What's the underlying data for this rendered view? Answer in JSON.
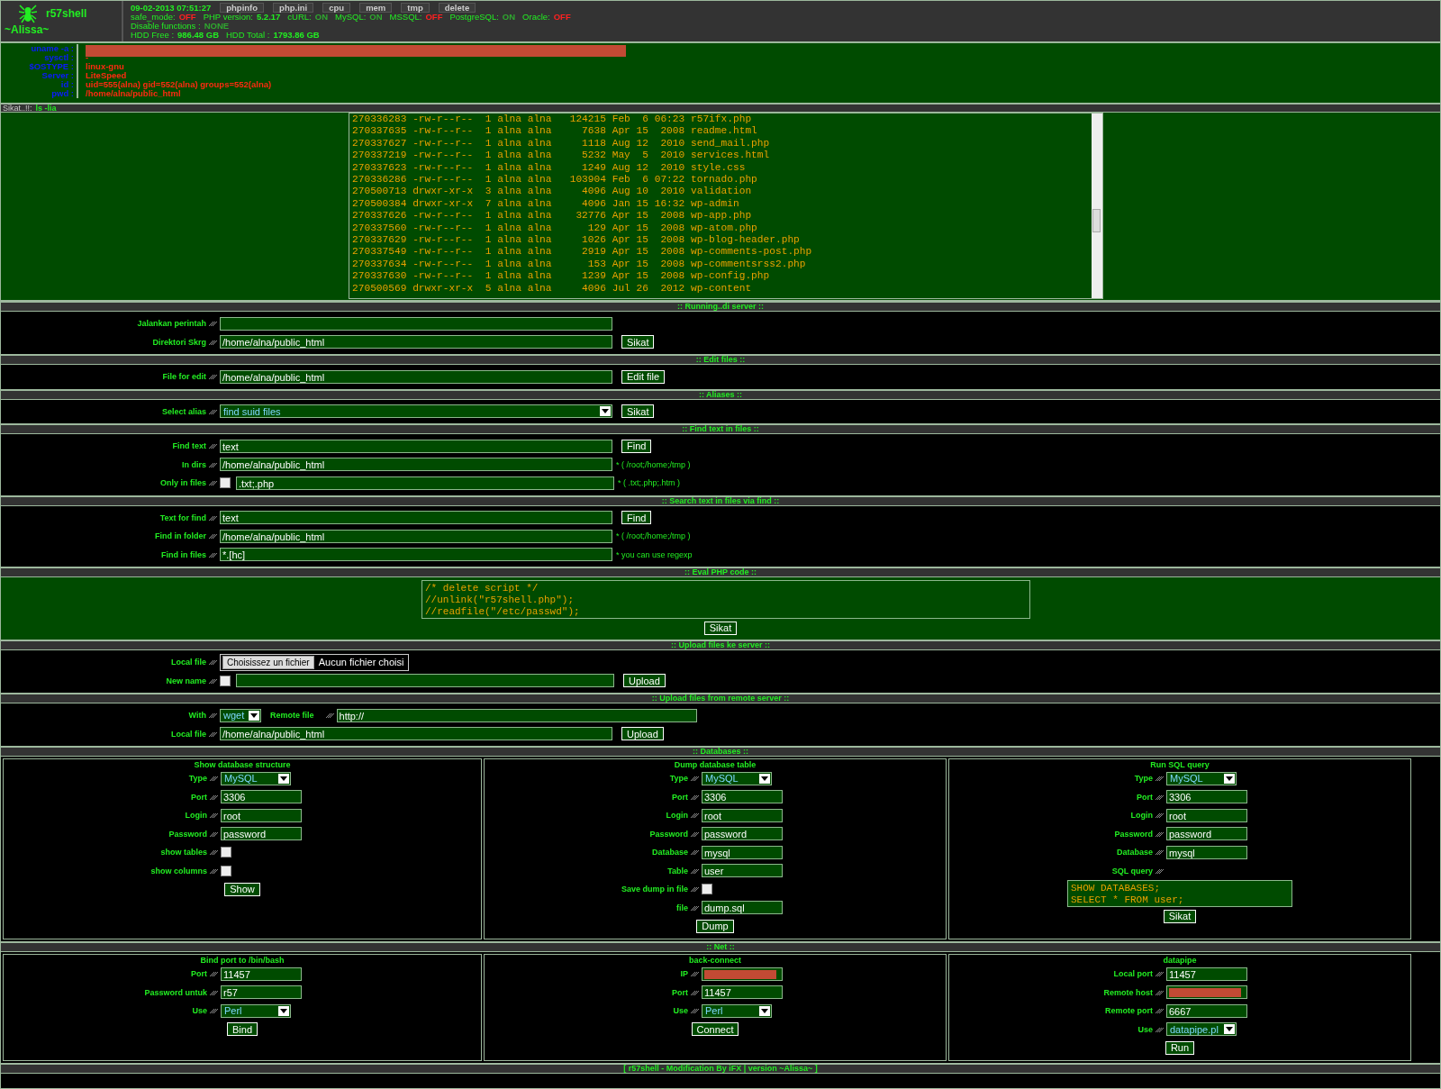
{
  "header": {
    "logo_name": "r57shell",
    "user": "~Alissa~",
    "datetime": "09-02-2013 07:51:27",
    "menu": [
      "phpinfo",
      "php.ini",
      "cpu",
      "mem",
      "tmp",
      "delete"
    ],
    "status": [
      {
        "label": "safe_mode:",
        "value": "OFF",
        "on": false
      },
      {
        "label": "PHP version:",
        "value": "5.2.17"
      },
      {
        "label": "cURL:",
        "value": "ON",
        "on": true
      },
      {
        "label": "MySQL:",
        "value": "ON",
        "on": true
      },
      {
        "label": "MSSQL:",
        "value": "OFF",
        "on": false
      },
      {
        "label": "PostgreSQL:",
        "value": "ON",
        "on": true
      },
      {
        "label": "Oracle:",
        "value": "OFF",
        "on": false
      }
    ],
    "disable_functions": {
      "label": "Disable functions :",
      "value": "NONE"
    },
    "hdd": {
      "free_label": "HDD Free :",
      "free": "986.48 GB",
      "total_label": "HDD Total :",
      "total": "1793.86 GB"
    }
  },
  "info": [
    {
      "label": "uname -a :",
      "redacted": true
    },
    {
      "label": "sysctl :",
      "value": "-"
    },
    {
      "label": "$OSTYPE :",
      "value": "linux-gnu"
    },
    {
      "label": "Server :",
      "value": "LiteSpeed"
    },
    {
      "label": "id :",
      "value": "uid=555(alna) gid=552(alna) groups=552(alna)"
    },
    {
      "label": "pwd :",
      "value": "/home/alna/public_html"
    }
  ],
  "command": {
    "label": "Sikat..!!:",
    "value": "ls -lia"
  },
  "listing": [
    "270336283 -rw-r--r--  1 alna alna   124215 Feb  6 06:23 r57ifx.php",
    "270337635 -rw-r--r--  1 alna alna     7638 Apr 15  2008 readme.html",
    "270337627 -rw-r--r--  1 alna alna     1118 Aug 12  2010 send_mail.php",
    "270337219 -rw-r--r--  1 alna alna     5232 May  5  2010 services.html",
    "270337623 -rw-r--r--  1 alna alna     1249 Aug 12  2010 style.css",
    "270336286 -rw-r--r--  1 alna alna   103904 Feb  6 07:22 tornado.php",
    "270500713 drwxr-xr-x  3 alna alna     4096 Aug 10  2010 validation",
    "270500384 drwxr-xr-x  7 alna alna     4096 Jan 15 16:32 wp-admin",
    "270337626 -rw-r--r--  1 alna alna    32776 Apr 15  2008 wp-app.php",
    "270337560 -rw-r--r--  1 alna alna      129 Apr 15  2008 wp-atom.php",
    "270337629 -rw-r--r--  1 alna alna     1026 Apr 15  2008 wp-blog-header.php",
    "270337549 -rw-r--r--  1 alna alna     2919 Apr 15  2008 wp-comments-post.php",
    "270337634 -rw-r--r--  1 alna alna      153 Apr 15  2008 wp-commentsrss2.php",
    "270337630 -rw-r--r--  1 alna alna     1239 Apr 15  2008 wp-config.php",
    "270500569 drwxr-xr-x  5 alna alna     4096 Jul 26  2012 wp-content"
  ],
  "sections": [
    {
      "title": ":: Running..di server ::",
      "kind": "form",
      "rows": [
        {
          "label": "Jalankan perintah",
          "items": [
            {
              "kind": "input"
            }
          ]
        },
        {
          "label": "Direktori Skrg",
          "items": [
            {
              "kind": "input",
              "value": "/home/alna/public_html"
            },
            {
              "kind": "button",
              "label": "Sikat"
            }
          ]
        }
      ]
    },
    {
      "title": ":: Edit files ::",
      "kind": "form",
      "rows": [
        {
          "label": "File for edit",
          "items": [
            {
              "kind": "input",
              "value": "/home/alna/public_html"
            },
            {
              "kind": "button",
              "label": "Edit file"
            }
          ]
        }
      ]
    },
    {
      "title": ":: Aliases ::",
      "kind": "form",
      "rows": [
        {
          "label": "Select alias",
          "items": [
            {
              "kind": "select",
              "value": "find suid files"
            },
            {
              "kind": "button",
              "label": "Sikat"
            }
          ]
        }
      ]
    },
    {
      "title": ":: Find text in files ::",
      "kind": "form",
      "rows": [
        {
          "label": "Find text",
          "items": [
            {
              "kind": "input",
              "value": "text"
            },
            {
              "kind": "button",
              "label": "Find"
            }
          ]
        },
        {
          "label": "In dirs",
          "items": [
            {
              "kind": "input",
              "value": "/home/alna/public_html"
            },
            {
              "kind": "hint",
              "text": "* ( /root;/home;/tmp )"
            }
          ]
        },
        {
          "label": "Only in files",
          "items": [
            {
              "kind": "checkbox",
              "checked": false
            },
            {
              "kind": "input",
              "value": ".txt;.php"
            },
            {
              "kind": "hint",
              "text": "* ( .txt;.php;.htm )"
            }
          ]
        }
      ]
    },
    {
      "title": ":: Search text in files via find ::",
      "kind": "form",
      "rows": [
        {
          "label": "Text for find",
          "items": [
            {
              "kind": "input",
              "value": "text"
            },
            {
              "kind": "button",
              "label": "Find"
            }
          ]
        },
        {
          "label": "Find in folder",
          "items": [
            {
              "kind": "input",
              "value": "/home/alna/public_html"
            },
            {
              "kind": "hint",
              "text": "* ( /root;/home;/tmp )"
            }
          ]
        },
        {
          "label": "Find in files",
          "items": [
            {
              "kind": "input",
              "value": "*.[hc]"
            },
            {
              "kind": "hint",
              "text": "* you can use regexp"
            }
          ]
        }
      ]
    },
    {
      "title": ":: Eval PHP code ::",
      "kind": "centered",
      "rows": [
        {
          "items": [
            {
              "kind": "textarea",
              "lines": [
                "/* delete script */",
                "//unlink(\"r57shell.php\");",
                "//readfile(\"/etc/passwd\");"
              ]
            }
          ]
        },
        {
          "items": [
            {
              "kind": "button",
              "label": "Sikat"
            }
          ]
        }
      ]
    },
    {
      "title": ":: Upload files ke server ::",
      "kind": "form",
      "rows": [
        {
          "label": "Local file",
          "items": [
            {
              "kind": "file",
              "button": "Choisissez un fichier",
              "text": "Aucun fichier choisi"
            }
          ]
        },
        {
          "label": "New name",
          "items": [
            {
              "kind": "checkbox",
              "checked": false
            },
            {
              "kind": "input"
            },
            {
              "kind": "button",
              "label": "Upload"
            }
          ]
        }
      ]
    },
    {
      "title": ":: Upload files from remote server ::",
      "kind": "form",
      "rows": [
        {
          "label": "With",
          "items": [
            {
              "kind": "select",
              "value": "wget"
            },
            {
              "kind": "label",
              "text": "Remote file"
            },
            {
              "kind": "input",
              "value": "http://"
            }
          ]
        },
        {
          "label": "Local file",
          "items": [
            {
              "kind": "input",
              "value": "/home/alna/public_html"
            },
            {
              "kind": "button",
              "label": "Upload"
            }
          ]
        }
      ]
    },
    {
      "title": ":: Databases ::",
      "kind": "columns",
      "columns": [
        {
          "title": "Show database structure",
          "rows": [
            {
              "label": "Type",
              "items": [
                {
                  "kind": "select",
                  "value": "MySQL"
                }
              ]
            },
            {
              "label": "Port",
              "items": [
                {
                  "kind": "input",
                  "value": "3306"
                }
              ]
            },
            {
              "label": "Login",
              "items": [
                {
                  "kind": "input",
                  "value": "root"
                }
              ]
            },
            {
              "label": "Password",
              "items": [
                {
                  "kind": "input",
                  "value": "password"
                }
              ]
            },
            {
              "label": "show tables",
              "items": [
                {
                  "kind": "checkbox",
                  "checked": false
                }
              ]
            },
            {
              "label": "show columns",
              "items": [
                {
                  "kind": "checkbox",
                  "checked": false
                }
              ]
            },
            {
              "items": [
                {
                  "kind": "button",
                  "label": "Show"
                }
              ]
            }
          ]
        },
        {
          "title": "Dump database table",
          "rows": [
            {
              "label": "Type",
              "items": [
                {
                  "kind": "select",
                  "value": "MySQL"
                }
              ]
            },
            {
              "label": "Port",
              "items": [
                {
                  "kind": "input",
                  "value": "3306"
                }
              ]
            },
            {
              "label": "Login",
              "items": [
                {
                  "kind": "input",
                  "value": "root"
                }
              ]
            },
            {
              "label": "Password",
              "items": [
                {
                  "kind": "input",
                  "value": "password"
                }
              ]
            },
            {
              "label": "Database",
              "items": [
                {
                  "kind": "input",
                  "value": "mysql"
                }
              ]
            },
            {
              "label": "Table",
              "items": [
                {
                  "kind": "input",
                  "value": "user"
                }
              ]
            },
            {
              "label": "Save dump in file",
              "items": [
                {
                  "kind": "checkbox",
                  "checked": false
                }
              ]
            },
            {
              "label": "file",
              "items": [
                {
                  "kind": "input",
                  "value": "dump.sql"
                }
              ]
            },
            {
              "items": [
                {
                  "kind": "button",
                  "label": "Dump"
                }
              ]
            }
          ]
        },
        {
          "title": "Run SQL query",
          "rows": [
            {
              "label": "Type",
              "items": [
                {
                  "kind": "select",
                  "value": "MySQL"
                }
              ]
            },
            {
              "label": "Port",
              "items": [
                {
                  "kind": "input",
                  "value": "3306"
                }
              ]
            },
            {
              "label": "Login",
              "items": [
                {
                  "kind": "input",
                  "value": "root"
                }
              ]
            },
            {
              "label": "Password",
              "items": [
                {
                  "kind": "input",
                  "value": "password"
                }
              ]
            },
            {
              "label": "Database",
              "items": [
                {
                  "kind": "input",
                  "value": "mysql"
                }
              ]
            },
            {
              "label": "SQL query",
              "items": []
            },
            {
              "items": [
                {
                  "kind": "textarea",
                  "lines": [
                    "SHOW DATABASES;",
                    "SELECT * FROM user;"
                  ]
                }
              ]
            },
            {
              "items": [
                {
                  "kind": "button",
                  "label": "Sikat"
                }
              ]
            }
          ]
        }
      ]
    },
    {
      "title": ":: Net ::",
      "kind": "columns",
      "columns": [
        {
          "title": "Bind port to /bin/bash",
          "rows": [
            {
              "label": "Port",
              "items": [
                {
                  "kind": "input",
                  "value": "11457"
                }
              ]
            },
            {
              "label": "Password untuk",
              "items": [
                {
                  "kind": "input",
                  "value": "r57"
                }
              ]
            },
            {
              "label": "Use",
              "items": [
                {
                  "kind": "select",
                  "value": "Perl"
                }
              ]
            },
            {
              "items": [
                {
                  "kind": "button",
                  "label": "Bind"
                }
              ]
            }
          ]
        },
        {
          "title": "back-connect",
          "rows": [
            {
              "label": "IP",
              "items": [
                {
                  "kind": "input",
                  "redacted": true
                }
              ]
            },
            {
              "label": "Port",
              "items": [
                {
                  "kind": "input",
                  "value": "11457"
                }
              ]
            },
            {
              "label": "Use",
              "items": [
                {
                  "kind": "select",
                  "value": "Perl"
                }
              ]
            },
            {
              "items": [
                {
                  "kind": "button",
                  "label": "Connect"
                }
              ]
            }
          ]
        },
        {
          "title": "datapipe",
          "rows": [
            {
              "label": "Local port",
              "items": [
                {
                  "kind": "input",
                  "value": "11457"
                }
              ]
            },
            {
              "label": "Remote host",
              "items": [
                {
                  "kind": "input",
                  "redacted": true
                }
              ]
            },
            {
              "label": "Remote port",
              "items": [
                {
                  "kind": "input",
                  "value": "6667"
                }
              ]
            },
            {
              "label": "Use",
              "items": [
                {
                  "kind": "select",
                  "value": "datapipe.pl"
                }
              ]
            },
            {
              "items": [
                {
                  "kind": "button",
                  "label": "Run"
                }
              ]
            }
          ]
        }
      ]
    }
  ],
  "footer": "[ r57shell - Modification By iFX | version ~Alissa~ ]"
}
